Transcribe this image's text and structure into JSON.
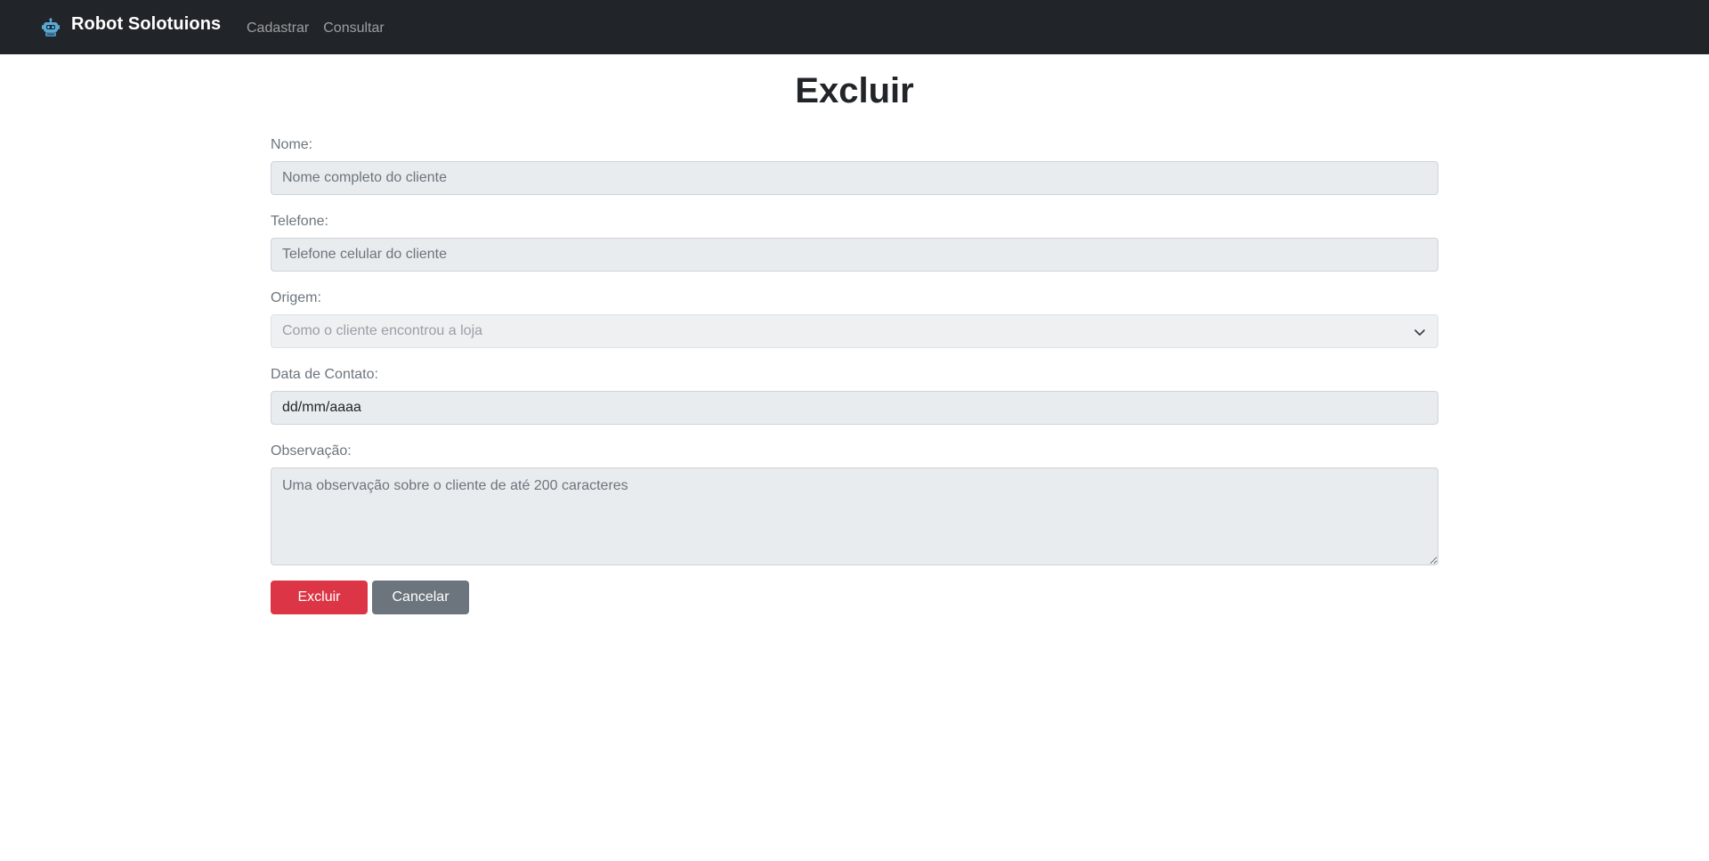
{
  "navbar": {
    "brand": "Robot Solotuions",
    "brand_icon": "robot-icon",
    "links": [
      "Cadastrar",
      "Consultar"
    ]
  },
  "page": {
    "title": "Excluir"
  },
  "form": {
    "nome": {
      "label": "Nome:",
      "placeholder": "Nome completo do cliente",
      "value": ""
    },
    "telefone": {
      "label": "Telefone:",
      "placeholder": "Telefone celular do cliente",
      "value": ""
    },
    "origem": {
      "label": "Origem:",
      "selected": "Como o cliente encontrou a loja"
    },
    "data_contato": {
      "label": "Data de Contato:",
      "value": "dd/mm/aaaa"
    },
    "observacao": {
      "label": "Observação:",
      "placeholder": "Uma observação sobre o cliente de até 200 caracteres",
      "value": ""
    }
  },
  "buttons": {
    "delete": "Excluir",
    "cancel": "Cancelar"
  },
  "colors": {
    "navbar": "#212529",
    "danger": "#dc3545",
    "secondary": "#6c757d",
    "input_bg": "#e9ecef"
  }
}
